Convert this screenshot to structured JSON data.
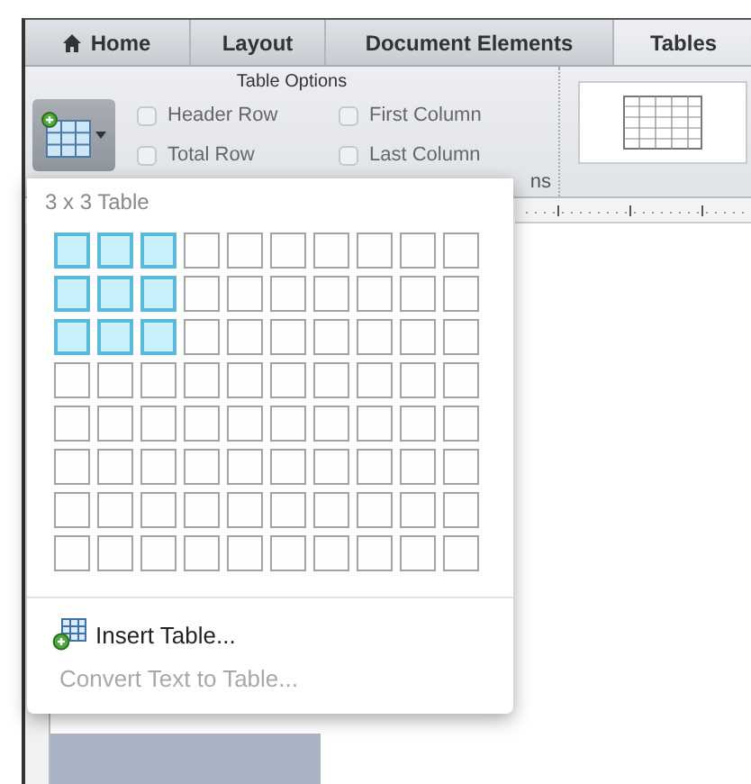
{
  "tabs": [
    {
      "label": "Home",
      "selected": false,
      "kind": "home"
    },
    {
      "label": "Layout",
      "selected": false,
      "kind": "plain"
    },
    {
      "label": "Document Elements",
      "selected": false,
      "kind": "plain"
    },
    {
      "label": "Tables",
      "selected": true,
      "kind": "plain"
    }
  ],
  "ribbon": {
    "group_title": "Table Options",
    "checkboxes": [
      {
        "label": "Header Row",
        "checked": false
      },
      {
        "label": "Total Row",
        "checked": false
      },
      {
        "label": "First Column",
        "checked": false
      },
      {
        "label": "Last Column",
        "checked": false
      }
    ],
    "partial_label": "ns"
  },
  "table_menu": {
    "title": "3 x 3 Table",
    "grid": [
      [
        true,
        true,
        true,
        false,
        false,
        false,
        false,
        false,
        false,
        false
      ],
      [
        true,
        true,
        true,
        false,
        false,
        false,
        false,
        false,
        false,
        false
      ],
      [
        true,
        true,
        true,
        false,
        false,
        false,
        false,
        false,
        false,
        false
      ],
      [
        false,
        false,
        false,
        false,
        false,
        false,
        false,
        false,
        false,
        false
      ],
      [
        false,
        false,
        false,
        false,
        false,
        false,
        false,
        false,
        false,
        false
      ],
      [
        false,
        false,
        false,
        false,
        false,
        false,
        false,
        false,
        false,
        false
      ],
      [
        false,
        false,
        false,
        false,
        false,
        false,
        false,
        false,
        false,
        false
      ],
      [
        false,
        false,
        false,
        false,
        false,
        false,
        false,
        false,
        false,
        false
      ]
    ],
    "items": [
      {
        "label": "Insert Table...",
        "disabled": false,
        "kind": "insert"
      },
      {
        "label": "Convert Text to Table...",
        "disabled": true,
        "kind": "plain"
      }
    ]
  }
}
